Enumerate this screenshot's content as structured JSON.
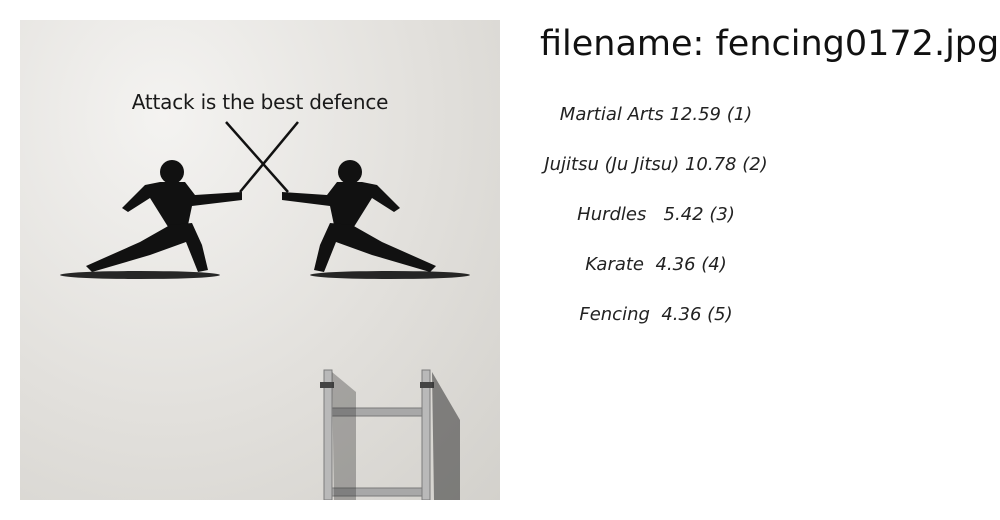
{
  "image": {
    "wall_text": "Attack is the best defence"
  },
  "header": {
    "filename_label": "filename: fencing0172.jpg"
  },
  "results": [
    {
      "text": "Martial Arts 12.59 (1)"
    },
    {
      "text": "Jujitsu (Ju Jitsu) 10.78 (2)"
    },
    {
      "text": "Hurdles   5.42 (3)"
    },
    {
      "text": "Karate  4.36 (4)"
    },
    {
      "text": "Fencing  4.36 (5)"
    }
  ]
}
